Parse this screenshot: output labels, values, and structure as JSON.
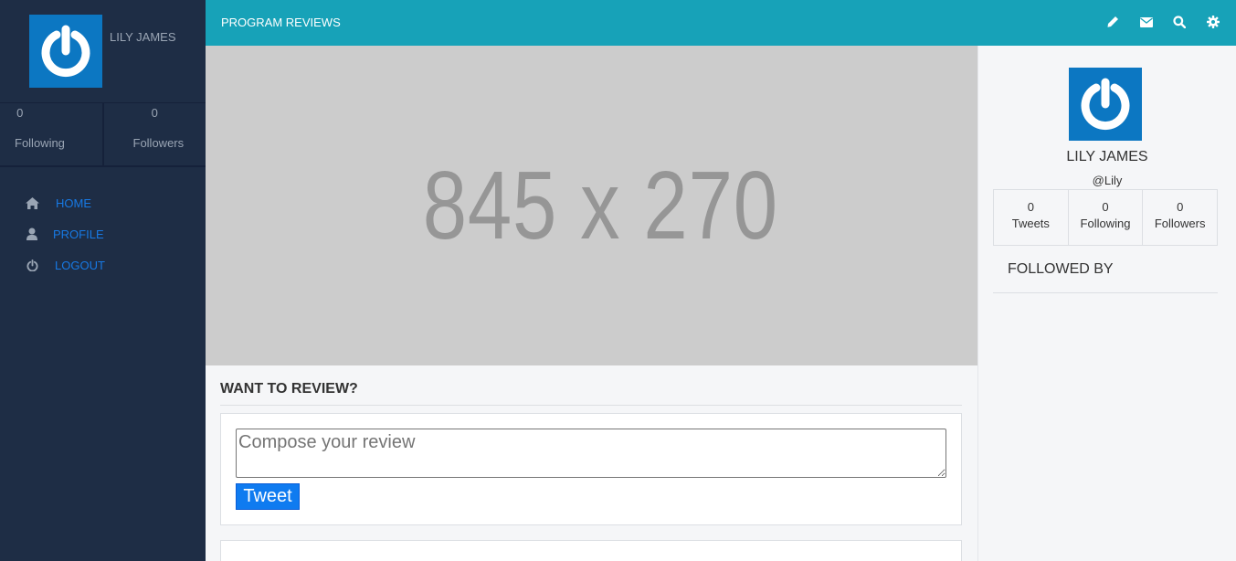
{
  "sidebar": {
    "user_name": "LILY JAMES",
    "stats": [
      {
        "value": "0",
        "label": "Following"
      },
      {
        "value": "0",
        "label": "Followers"
      }
    ],
    "nav": [
      {
        "label": "HOME",
        "icon": "home-icon"
      },
      {
        "label": "PROFILE",
        "icon": "user-icon"
      },
      {
        "label": "LOGOUT",
        "icon": "power-icon"
      }
    ]
  },
  "topbar": {
    "title": "PROGRAM REVIEWS",
    "icons": [
      "pencil-icon",
      "envelope-icon",
      "search-icon",
      "gear-icon"
    ]
  },
  "main": {
    "banner_text": "845 x 270",
    "review_heading": "WANT TO REVIEW?",
    "compose_placeholder": "Compose your review",
    "tweet_button": "Tweet"
  },
  "profile_panel": {
    "name": "LILY JAMES",
    "handle": "@Lily",
    "stats": [
      {
        "value": "0",
        "label": "Tweets"
      },
      {
        "value": "0",
        "label": "Following"
      },
      {
        "value": "0",
        "label": "Followers"
      }
    ],
    "followed_by_heading": "FOLLOWED BY"
  },
  "colors": {
    "sidebar_bg": "#1e2d45",
    "topbar_bg": "#17a2b8",
    "link": "#1779e4",
    "button": "#0f7bf0",
    "avatar_bg": "#0c77c2"
  }
}
